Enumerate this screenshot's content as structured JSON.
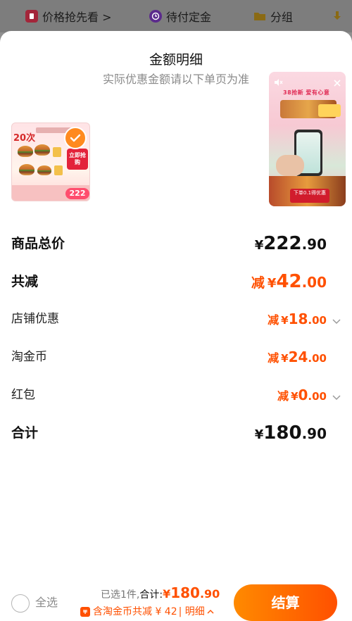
{
  "topbar": {
    "price_grab": "价格抢先看 >",
    "pending_deposit": "待付定金",
    "group": "分组"
  },
  "sheet": {
    "title": "金额明细",
    "subtitle": "实际优惠金额请以下单页为准"
  },
  "video": {
    "headline": "38抢新 爱有心意",
    "button_text": "下单0.1得优惠"
  },
  "thumbnail": {
    "count_label": "20次",
    "cta_label": "立即抢购",
    "price_label": "222"
  },
  "details": {
    "total_price": {
      "label": "商品总价",
      "currency": "¥",
      "integer": "222",
      "decimal": ".90"
    },
    "total_reduction": {
      "label": "共减",
      "prefix": "减",
      "currency": "¥",
      "integer": "42",
      "decimal": ".00"
    },
    "store_discount": {
      "label": "店铺优惠",
      "prefix": "减",
      "currency": "¥",
      "integer": "18",
      "decimal": ".00"
    },
    "tao_coin": {
      "label": "淘金币",
      "prefix": "减",
      "currency": "¥",
      "integer": "24",
      "decimal": ".00"
    },
    "red_packet": {
      "label": "红包",
      "prefix": "减",
      "currency": "¥",
      "integer": "0",
      "decimal": ".00"
    },
    "sum": {
      "label": "合计",
      "currency": "¥",
      "integer": "180",
      "decimal": ".90"
    }
  },
  "bottombar": {
    "select_all": "全选",
    "selected_count": "已选1件,",
    "total_label": "合计:",
    "total_currency": "¥",
    "total_integer": "180",
    "total_decimal": ".90",
    "discount_text": "含淘金币共减 ¥ 42",
    "details_link": "| 明细",
    "checkout": "结算"
  },
  "colors": {
    "accent": "#ff5000",
    "checkout_gradient_start": "#ff8a00",
    "select_check": "#ff8a1f"
  },
  "icons": [
    "tag-icon",
    "clock-icon",
    "folder-icon",
    "download-icon",
    "mute-icon",
    "close-icon",
    "check-icon",
    "chevron-down-icon",
    "chevron-up-icon",
    "coin-icon"
  ]
}
